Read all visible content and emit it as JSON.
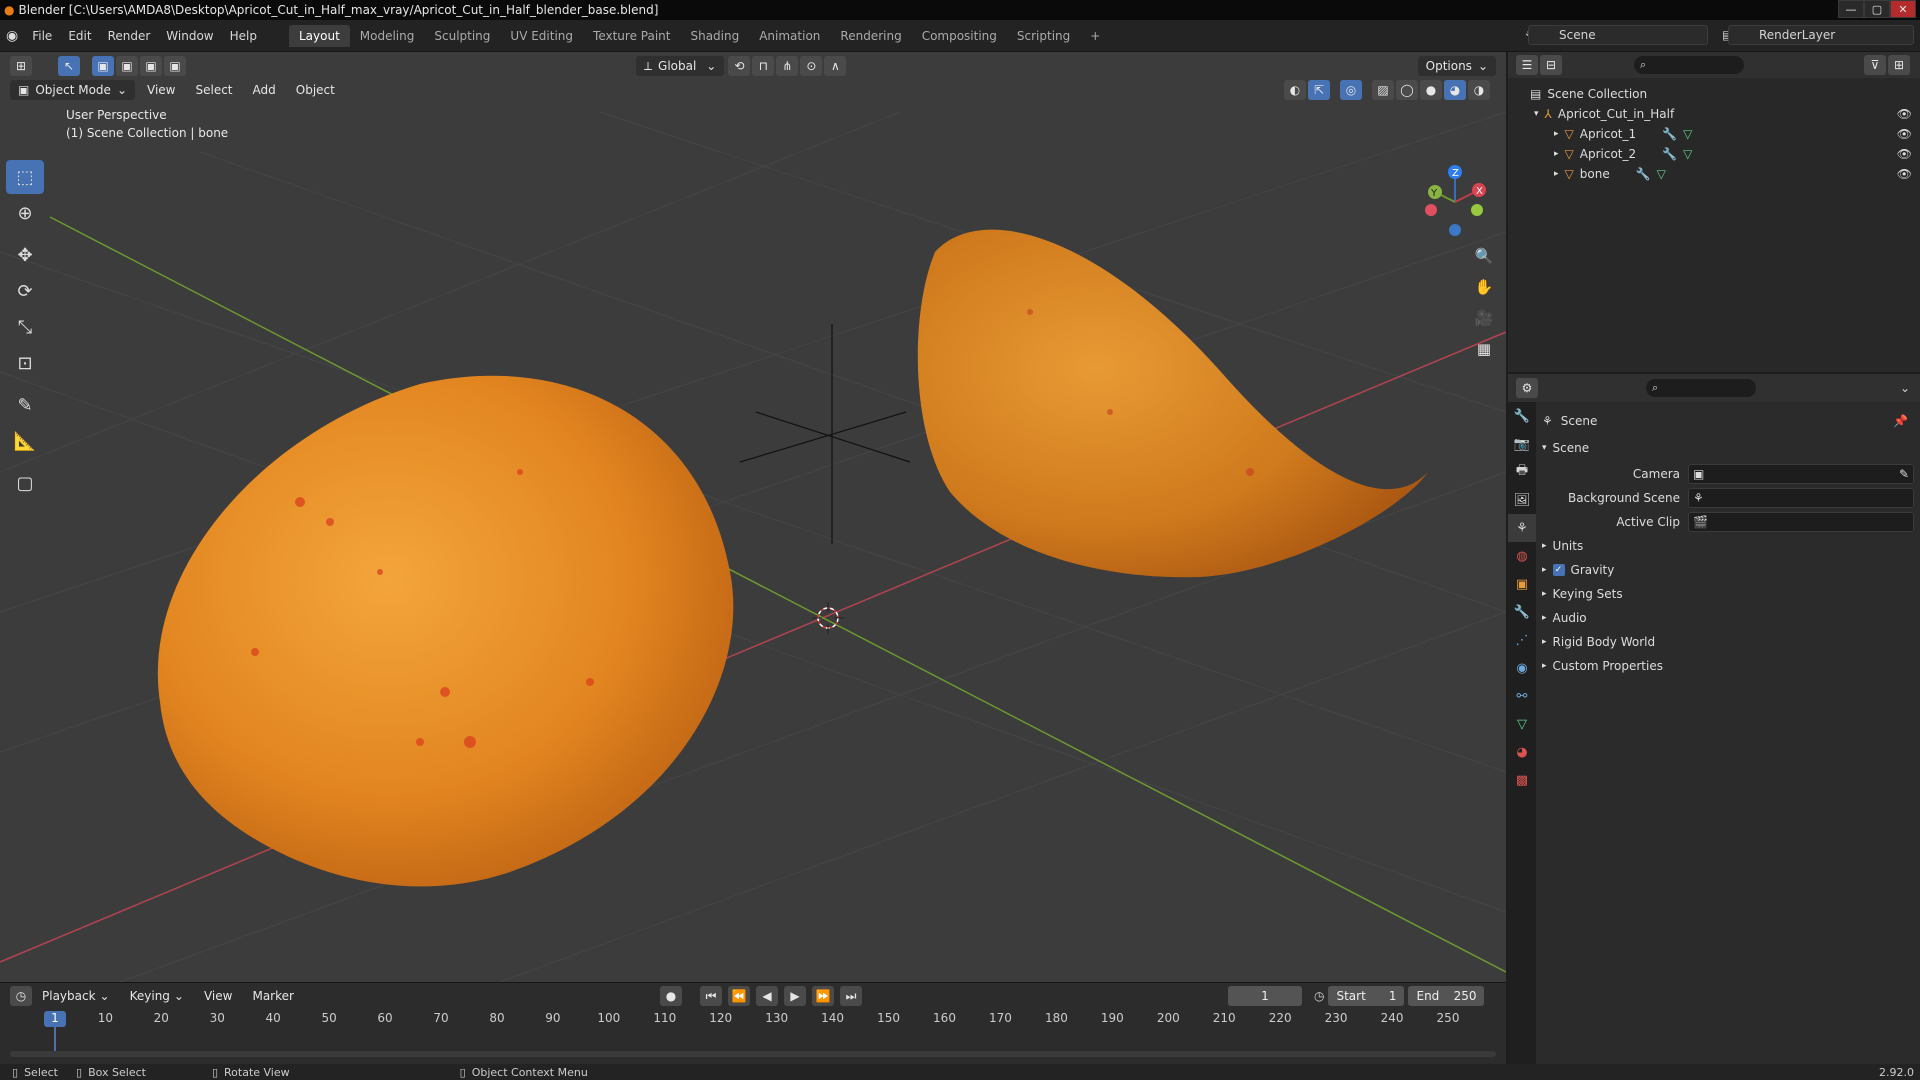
{
  "window": {
    "title": "Blender [C:\\Users\\AMDA8\\Desktop\\Apricot_Cut_in_Half_max_vray/Apricot_Cut_in_Half_blender_base.blend]",
    "version": "2.92.0"
  },
  "menu": [
    "File",
    "Edit",
    "Render",
    "Window",
    "Help"
  ],
  "workspaces": [
    "Layout",
    "Modeling",
    "Sculpting",
    "UV Editing",
    "Texture Paint",
    "Shading",
    "Animation",
    "Rendering",
    "Compositing",
    "Scripting"
  ],
  "active_workspace": "Layout",
  "scene_name": "Scene",
  "render_layer": "RenderLayer",
  "viewport": {
    "transform_orientation": "Global",
    "options_label": "Options",
    "mode": "Object Mode",
    "menus": [
      "View",
      "Select",
      "Add",
      "Object"
    ],
    "perspective": "User Perspective",
    "collection_info": "(1) Scene Collection | bone",
    "gizmo": {
      "x": "X",
      "y": "Y",
      "z": "Z"
    }
  },
  "outliner": {
    "root": "Scene Collection",
    "collection": "Apricot_Cut_in_Half",
    "objects": [
      "Apricot_1",
      "Apricot_2",
      "bone"
    ]
  },
  "properties": {
    "context": "Scene",
    "panel": "Scene",
    "fields": [
      {
        "label": "Camera"
      },
      {
        "label": "Background Scene"
      },
      {
        "label": "Active Clip"
      }
    ],
    "subpanels": [
      "Units",
      "Gravity",
      "Keying Sets",
      "Audio",
      "Rigid Body World",
      "Custom Properties"
    ],
    "gravity_checked": true
  },
  "timeline": {
    "menus": [
      "Playback",
      "Keying",
      "View",
      "Marker"
    ],
    "current_frame": "1",
    "start_label": "Start",
    "start": "1",
    "end_label": "End",
    "end": "250",
    "ticks": [
      "1",
      "10",
      "20",
      "30",
      "40",
      "50",
      "60",
      "70",
      "80",
      "90",
      "100",
      "110",
      "120",
      "130",
      "140",
      "150",
      "160",
      "170",
      "180",
      "190",
      "200",
      "210",
      "220",
      "230",
      "240",
      "250"
    ]
  },
  "status": {
    "select": "Select",
    "box_select": "Box Select",
    "rotate_view": "Rotate View",
    "context_menu": "Object Context Menu"
  },
  "colors": {
    "accent": "#4772b3",
    "x_axis": "#b0454f",
    "y_axis": "#6b9a2f",
    "apricot": "#e8882a"
  }
}
